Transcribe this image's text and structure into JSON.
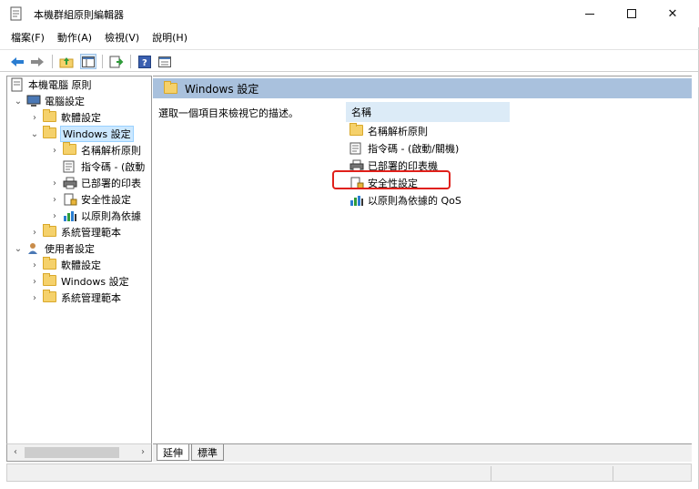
{
  "window": {
    "title": "本機群組原則編輯器",
    "controls": {
      "minimize": "minimize",
      "maximize": "maximize",
      "close": "✕"
    }
  },
  "menu": [
    "檔案(F)",
    "動作(A)",
    "檢視(V)",
    "說明(H)"
  ],
  "toolbar": {
    "icons": [
      "back-icon",
      "forward-icon",
      "up-folder-icon",
      "show-hide-tree-icon",
      "export-list-icon",
      "help-icon",
      "properties-icon"
    ]
  },
  "tree": {
    "root": "本機電腦 原則",
    "computer": "電腦設定",
    "computer_children": [
      "軟體設定",
      "Windows 設定",
      "系統管理範本"
    ],
    "windows_children": [
      "名稱解析原則",
      "指令碼 - (啟動",
      "已部署的印表",
      "安全性設定",
      "以原則為依據"
    ],
    "user": "使用者設定",
    "user_children": [
      "軟體設定",
      "Windows 設定",
      "系統管理範本"
    ]
  },
  "right": {
    "header": "Windows 設定",
    "description": "選取一個項目來檢視它的描述。",
    "column": "名稱",
    "items": [
      "名稱解析原則",
      "指令碼 - (啟動/關機)",
      "已部署的印表機",
      "安全性設定",
      "以原則為依據的 QoS"
    ],
    "highlighted_item": "安全性設定",
    "highlight_color": "#e0201a"
  },
  "tabs": [
    "延伸",
    "標準"
  ],
  "colors": {
    "header_bg": "#a9c1dd",
    "selection": "#cce8ff",
    "column_header": "#dcebf7"
  }
}
